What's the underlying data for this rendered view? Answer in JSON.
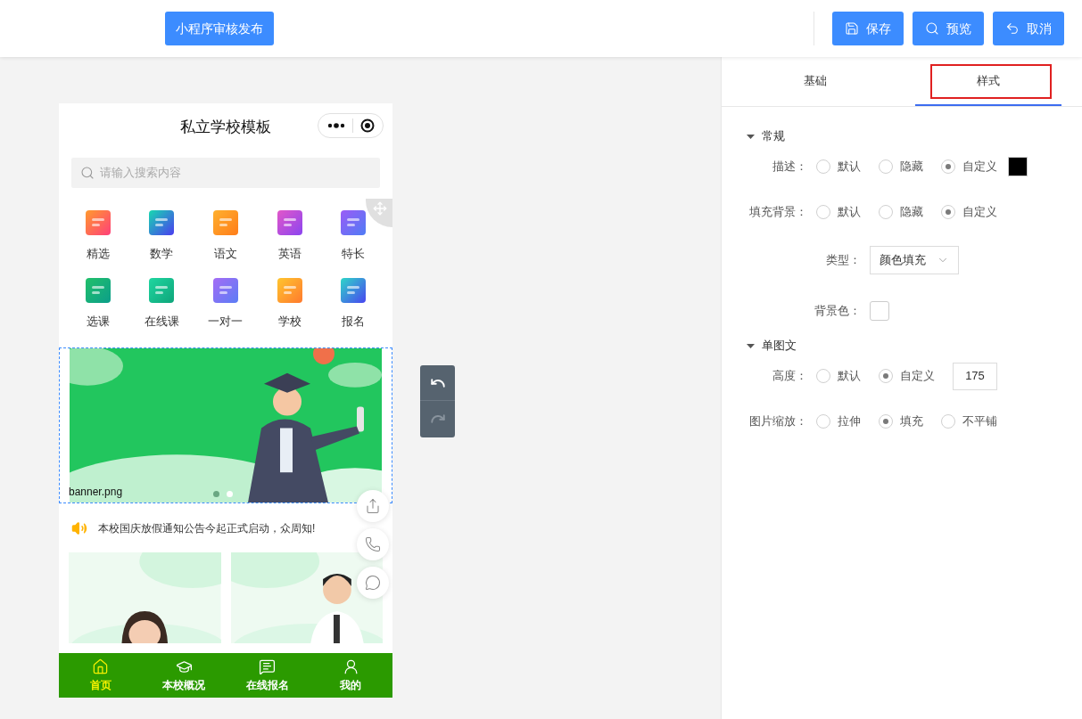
{
  "toolbar": {
    "publish_button": "小程序审核发布",
    "buttons": [
      {
        "kind": "save",
        "label": "保存"
      },
      {
        "kind": "preview",
        "label": "预览"
      },
      {
        "kind": "cancel",
        "label": "取消"
      }
    ]
  },
  "phone": {
    "title": "私立学校模板",
    "search": {
      "placeholder": "请输入搜索内容"
    },
    "grid": [
      {
        "label": "精选"
      },
      {
        "label": "数学"
      },
      {
        "label": "语文"
      },
      {
        "label": "英语"
      },
      {
        "label": "特长"
      },
      {
        "label": "选课"
      },
      {
        "label": "在线课"
      },
      {
        "label": "一对一"
      },
      {
        "label": "学校"
      },
      {
        "label": "报名"
      }
    ],
    "banner": {
      "filename": "banner.png",
      "dots": [
        {
          "selected": false
        },
        {
          "selected": true
        }
      ]
    },
    "notice": "本校国庆放假通知公告今起正式启动，众周知!",
    "nav": [
      {
        "kind": "home",
        "label": "首页",
        "selected": true
      },
      {
        "kind": "school",
        "label": "本校概况",
        "selected": false
      },
      {
        "kind": "message",
        "label": "在线报名",
        "selected": false
      },
      {
        "kind": "user",
        "label": "我的",
        "selected": false
      }
    ]
  },
  "panel": {
    "tabs": [
      {
        "label": "基础",
        "selected": false
      },
      {
        "label": "样式",
        "selected": true,
        "highlighted": true
      }
    ],
    "sections": [
      {
        "title": "常规",
        "expanded": true,
        "fields": [
          {
            "kind": "radio",
            "label": "描述：",
            "options": [
              {
                "label": "默认",
                "selected": false
              },
              {
                "label": "隐藏",
                "selected": false
              },
              {
                "label": "自定义",
                "selected": true
              }
            ],
            "color": "#000000"
          },
          {
            "kind": "radio",
            "label": "填充背景：",
            "options": [
              {
                "label": "默认",
                "selected": false
              },
              {
                "label": "隐藏",
                "selected": false
              },
              {
                "label": "自定义",
                "selected": true
              }
            ]
          },
          {
            "kind": "select",
            "label": "类型：",
            "value": "颜色填充"
          },
          {
            "kind": "color",
            "label": "背景色：",
            "color": "#ffffff"
          }
        ]
      },
      {
        "title": "单图文",
        "expanded": true,
        "fields": [
          {
            "kind": "radio",
            "label": "高度：",
            "options": [
              {
                "label": "默认",
                "selected": false
              },
              {
                "label": "自定义",
                "selected": true
              }
            ],
            "value": "175"
          },
          {
            "kind": "radio",
            "label": "图片缩放：",
            "options": [
              {
                "label": "拉伸",
                "selected": false
              },
              {
                "label": "填充",
                "selected": true
              },
              {
                "label": "不平铺",
                "selected": false
              }
            ]
          }
        ]
      }
    ]
  }
}
